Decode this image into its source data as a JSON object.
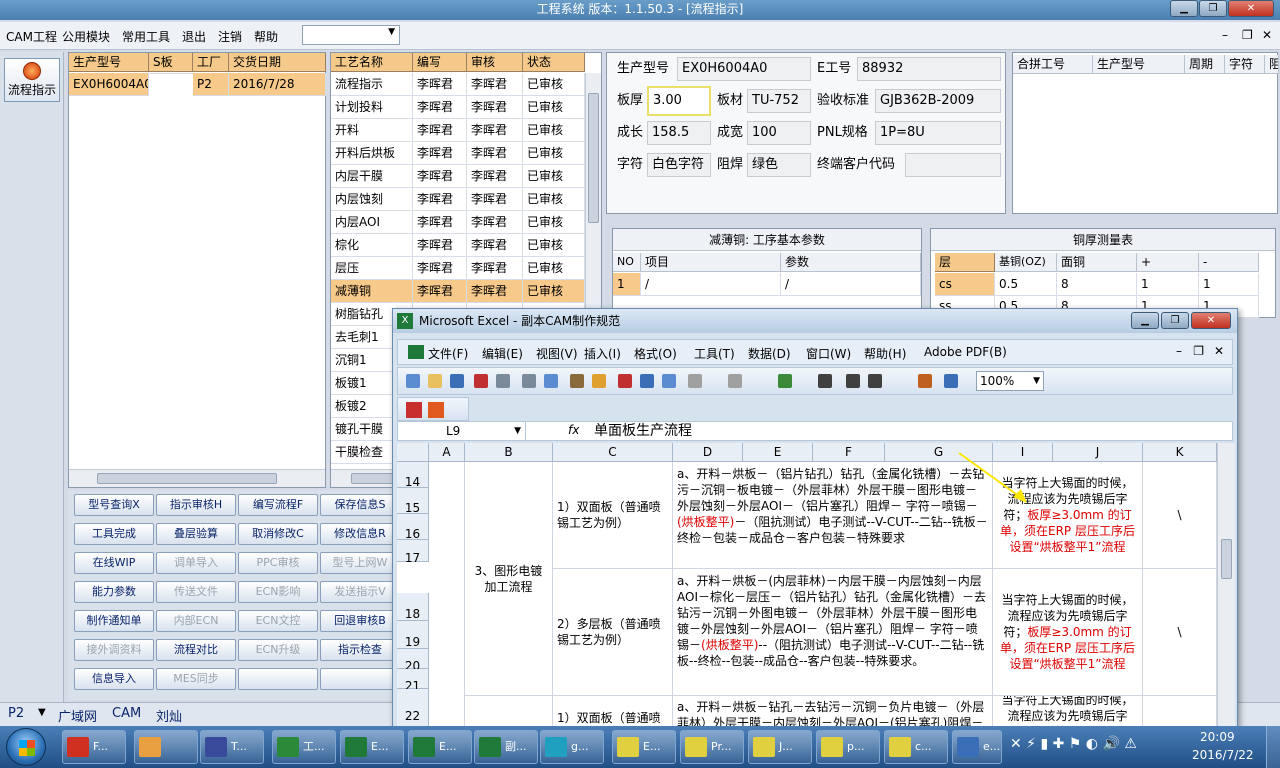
{
  "app": {
    "title": "工程系统  版本：1.1.50.3 - [流程指示]"
  },
  "menu": [
    "CAM工程",
    "公用模块",
    "常用工具",
    "退出",
    "注销",
    "帮助"
  ],
  "left": {
    "flow_button": "流程指示"
  },
  "product_table": {
    "headers": [
      "生产型号",
      "S板",
      "工厂",
      "交货日期"
    ],
    "row": [
      "EX0H6004A0",
      "",
      "P2",
      "2016/7/28"
    ]
  },
  "process_table": {
    "headers": [
      "工艺名称",
      "编写",
      "审核",
      "状态"
    ],
    "rows": [
      [
        "流程指示",
        "李晖君",
        "李晖君",
        "已审核"
      ],
      [
        "计划投料",
        "李晖君",
        "李晖君",
        "已审核"
      ],
      [
        "开料",
        "李晖君",
        "李晖君",
        "已审核"
      ],
      [
        "开料后烘板",
        "李晖君",
        "李晖君",
        "已审核"
      ],
      [
        "内层干膜",
        "李晖君",
        "李晖君",
        "已审核"
      ],
      [
        "内层蚀刻",
        "李晖君",
        "李晖君",
        "已审核"
      ],
      [
        "内层AOI",
        "李晖君",
        "李晖君",
        "已审核"
      ],
      [
        "棕化",
        "李晖君",
        "李晖君",
        "已审核"
      ],
      [
        "层压",
        "李晖君",
        "李晖君",
        "已审核"
      ],
      [
        "减薄铜",
        "李晖君",
        "李晖君",
        "已审核"
      ],
      [
        "树脂钻孔",
        "",
        "",
        ""
      ],
      [
        "去毛刺1",
        "",
        "",
        ""
      ],
      [
        "沉铜1",
        "",
        "",
        ""
      ],
      [
        "板镀1",
        "",
        "",
        ""
      ],
      [
        "板镀2",
        "",
        "",
        ""
      ],
      [
        "镀孔干膜",
        "",
        "",
        ""
      ],
      [
        "干膜检查",
        "",
        "",
        ""
      ]
    ]
  },
  "form": {
    "product_model_label": "生产型号",
    "product_model": "EX0H6004A0",
    "e_no_label": "E工号",
    "e_no": "88932",
    "thickness_label": "板厚",
    "thickness": "3.00",
    "material_label": "板材",
    "material": "TU-752",
    "standard_label": "验收标准",
    "standard": "GJB362B-2009",
    "length_label": "成长",
    "length": "158.5",
    "width_label": "成宽",
    "width": "100",
    "pnl_label": "PNL规格",
    "pnl": "1P=8U",
    "char_label": "字符",
    "char": "白色字符",
    "mask_label": "阻焊",
    "mask": "绿色",
    "client_label": "终端客户代码",
    "client": ""
  },
  "merge_table": {
    "headers": [
      "合拼工号",
      "生产型号",
      "周期",
      "字符",
      "阻"
    ]
  },
  "thin_copper": {
    "title": "减薄铜: 工序基本参数",
    "headers": [
      "NO",
      "项目",
      "参数"
    ],
    "row": [
      "1",
      "/",
      "/"
    ]
  },
  "copper_table": {
    "title": "铜厚测量表",
    "headers": [
      "层",
      "基铜(OZ)",
      "面铜",
      "+",
      "-"
    ],
    "rows": [
      [
        "cs",
        "0.5",
        "8",
        "1",
        "1"
      ],
      [
        "ss",
        "0.5",
        "8",
        "1",
        "1"
      ]
    ]
  },
  "buttons": [
    {
      "label": "型号查询X",
      "dis": false
    },
    {
      "label": "指示审核H",
      "dis": false
    },
    {
      "label": "编写流程F",
      "dis": false
    },
    {
      "label": "保存信息S",
      "dis": false
    },
    {
      "label": "工具完成",
      "dis": false
    },
    {
      "label": "叠层验算",
      "dis": false
    },
    {
      "label": "取消修改C",
      "dis": false
    },
    {
      "label": "修改信息R",
      "dis": false
    },
    {
      "label": "在线WIP",
      "dis": false
    },
    {
      "label": "调单导入",
      "dis": true
    },
    {
      "label": "PPC审核",
      "dis": true
    },
    {
      "label": "型号上网W",
      "dis": true
    },
    {
      "label": "能力参数",
      "dis": false
    },
    {
      "label": "传送文件",
      "dis": true
    },
    {
      "label": "ECN影响",
      "dis": true
    },
    {
      "label": "发送指示V",
      "dis": true
    },
    {
      "label": "制作通知单",
      "dis": false
    },
    {
      "label": "内部ECN",
      "dis": true
    },
    {
      "label": "ECN文控",
      "dis": true
    },
    {
      "label": "回退审核B",
      "dis": false
    },
    {
      "label": "接外调资料",
      "dis": true
    },
    {
      "label": "流程对比",
      "dis": false
    },
    {
      "label": "ECN升级",
      "dis": true
    },
    {
      "label": "指示检查",
      "dis": false
    },
    {
      "label": "信息导入",
      "dis": false
    },
    {
      "label": "MES同步",
      "dis": true
    },
    {
      "label": "",
      "dis": false
    },
    {
      "label": "",
      "dis": false
    }
  ],
  "status": {
    "factory": "P2",
    "items": [
      "广域网",
      "CAM",
      "刘灿"
    ]
  },
  "excel": {
    "title": "Microsoft Excel - 副本CAM制作规范",
    "menu": [
      "文件(F)",
      "编辑(E)",
      "视图(V)",
      "插入(I)",
      "格式(O)",
      "工具(T)",
      "数据(D)",
      "窗口(W)",
      "帮助(H)",
      "Adobe PDF(B)"
    ],
    "zoom": "100%",
    "cell_ref": "L9",
    "formula": "单面板生产流程",
    "columns": [
      "A",
      "B",
      "C",
      "D",
      "E",
      "F",
      "G",
      "I",
      "J",
      "K"
    ],
    "rows": [
      "14",
      "15",
      "16",
      "17",
      "18",
      "19",
      "20",
      "21",
      "22"
    ],
    "b_text": "3、图形电镀加工流程",
    "c1": "1）双面板（普通喷锡工艺为例）",
    "c2": "2）多层板（普通喷锡工艺为例）",
    "c3": "1）双面板（普通喷",
    "d1a": "a、开料－烘板－（铝片钻孔）钻孔（金属化铣槽）－去钻污－沉铜－板电镀－（外层菲林）外层干膜－图形电镀－外层蚀刻－外层AOI－（铝片塞孔）阻焊－ 字符－喷锡－",
    "d1r": "(烘板整平)",
    "d1b": "－（阻抗测试）电子测试--V-CUT--二钻--铣板－终检－包装－成品仓－客户包装－特殊要求",
    "d2a": "a、开料－烘板－(内层菲林)－内层干膜－内层蚀刻－内层AOI－棕化－层压－（铝片钻孔）钻孔（金属化铣槽）－去钻污－沉铜－外图电镀－（外层菲林）外层干膜－图形电镀－外层蚀刻－外层AOI－（铝片塞孔）阻焊－ 字符－喷锡－",
    "d2r": "(烘板整平)",
    "d2b": "--（阻抗测试）电子测试--V-CUT--二钻--铣板--终检--包装--成品仓--客户包装--特殊要求。",
    "d3": "a、开料－烘板－钻孔－去钻污－沉铜－负片电镀－（外层菲林）外层干膜－内层蚀刻－外层AOI－(铝片塞孔)阻焊－",
    "i_black": "当字符上大锡面的时候，流程应该为先喷锡后字符；",
    "i_red": "板厚≥3.0mm 的订单，须在ERP 层压工序后设置“烘板整平1”流程",
    "k": "\\"
  },
  "taskbar": {
    "tasks": [
      "F...",
      "",
      "T...",
      "工...",
      "E...",
      "E...",
      "副...",
      "g...",
      "E...",
      "Pr...",
      "J...",
      "p...",
      "c...",
      "e..."
    ],
    "time": "20:09",
    "date": "2016/7/22"
  }
}
